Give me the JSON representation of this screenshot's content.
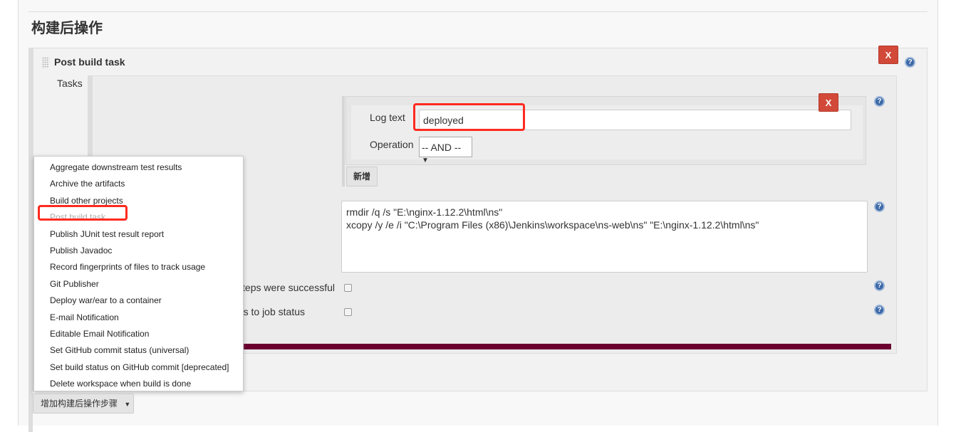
{
  "section_title": "构建后操作",
  "post_build_task": {
    "title": "Post build task",
    "delete_label": "X",
    "help_icon": "?",
    "tasks_label": "Tasks",
    "log_panel": {
      "log_text_label": "Log text",
      "log_text_value": "deployed",
      "operation_label": "Operation",
      "operation_value": "-- AND --",
      "delete_label": "X",
      "add_label": "新增"
    },
    "script": "rmdir /q /s \"E:\\nginx-1.12.2\\html\\ns\"\nxcopy /y /e /i \"C:\\Program Files (x86)\\Jenkins\\workspace\\ns-web\\ns\" \"E:\\nginx-1.12.2\\html\\ns\"",
    "checkbox1_label": "steps were successful",
    "checkbox2_label": "us to job status"
  },
  "menu": {
    "items": [
      {
        "label": "Aggregate downstream test results"
      },
      {
        "label": "Archive the artifacts"
      },
      {
        "label": "Build other projects"
      },
      {
        "label": "Post build task",
        "disabled": true
      },
      {
        "label": "Publish JUnit test result report"
      },
      {
        "label": "Publish Javadoc"
      },
      {
        "label": "Record fingerprints of files to track usage"
      },
      {
        "label": "Git Publisher"
      },
      {
        "label": "Deploy war/ear to a container"
      },
      {
        "label": "E-mail Notification"
      },
      {
        "label": "Editable Email Notification"
      },
      {
        "label": "Set GitHub commit status (universal)"
      },
      {
        "label": "Set build status on GitHub commit [deprecated]"
      },
      {
        "label": "Delete workspace when build is done"
      }
    ]
  },
  "add_step_button": "增加构建后操作步骤",
  "colors": {
    "delete": "#d24939",
    "highlight": "#ff2a1f",
    "bar": "#6b0030"
  }
}
